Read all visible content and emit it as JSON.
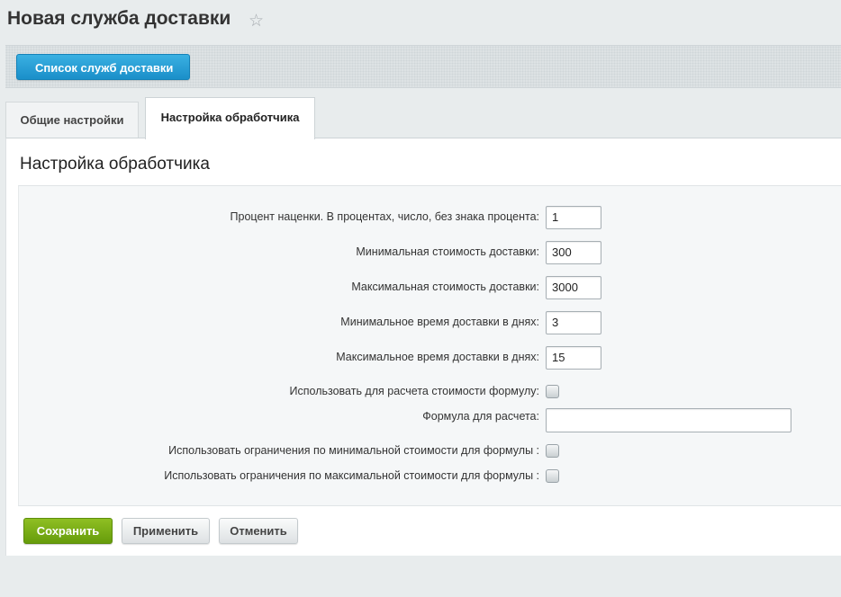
{
  "header": {
    "title": "Новая служба доставки",
    "favorite_icon": "star-icon"
  },
  "toolbar": {
    "back_label": "Список служб доставки"
  },
  "tabs": [
    {
      "label": "Общие настройки",
      "active": false
    },
    {
      "label": "Настройка обработчика",
      "active": true
    }
  ],
  "panel": {
    "title": "Настройка обработчика"
  },
  "fields": {
    "markup_percent": {
      "label": "Процент наценки. В процентах, число, без знака процента:",
      "value": "1"
    },
    "min_cost": {
      "label": "Минимальная стоимость доставки:",
      "value": "300"
    },
    "max_cost": {
      "label": "Максимальная стоимость доставки:",
      "value": "3000"
    },
    "min_days": {
      "label": "Минимальное время доставки в днях:",
      "value": "3"
    },
    "max_days": {
      "label": "Максимальное время доставки в днях:",
      "value": "15"
    },
    "use_formula": {
      "label": "Использовать для расчета стоимости формулу:",
      "checked": false
    },
    "formula": {
      "label": "Формула для расчета:",
      "value": ""
    },
    "use_min_limit": {
      "label": "Использовать ограничения по минимальной стоимости для формулы :",
      "checked": false
    },
    "use_max_limit": {
      "label": "Использовать ограничения по максимальной стоимости для формулы :",
      "checked": false
    }
  },
  "buttons": {
    "save": "Сохранить",
    "apply": "Применить",
    "cancel": "Отменить"
  },
  "colors": {
    "accent_blue": "#1a8fc9",
    "save_green": "#669c0b",
    "background": "#e8eced"
  }
}
